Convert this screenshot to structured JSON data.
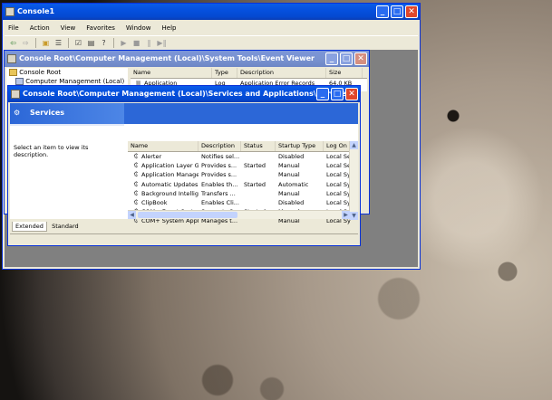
{
  "console_window": {
    "title": "Console1",
    "menu": [
      "File",
      "Action",
      "View",
      "Favorites",
      "Window",
      "Help"
    ],
    "toolbar_icons": [
      "back-icon",
      "forward-icon",
      "up-folder-icon",
      "show-hide-tree-icon",
      "properties-icon",
      "export-list-icon",
      "help-icon",
      "play-icon",
      "stop-icon",
      "pause-icon",
      "restart-icon"
    ]
  },
  "event_viewer_window": {
    "title": "Console Root\\Computer Management (Local)\\System Tools\\Event Viewer",
    "tree": [
      "Console Root",
      "Computer Management (Local)"
    ],
    "columns": [
      "Name",
      "Type",
      "Description",
      "Size"
    ],
    "rows": [
      {
        "name": "Application",
        "type": "Log",
        "description": "Application Error Records",
        "size": "64.0 KB"
      }
    ]
  },
  "services_window": {
    "title": "Console Root\\Computer Management (Local)\\Services and Applications\\Services",
    "header": "Services",
    "left_text": "Select an item to view its description.",
    "columns": [
      "Name",
      "Description",
      "Status",
      "Startup Type",
      "Log On A"
    ],
    "rows": [
      {
        "name": "Alerter",
        "description": "Notifies sel...",
        "status": "",
        "startup": "Disabled",
        "logon": "Local Ser"
      },
      {
        "name": "Application Layer G...",
        "description": "Provides s...",
        "status": "Started",
        "startup": "Manual",
        "logon": "Local Ser"
      },
      {
        "name": "Application Manage...",
        "description": "Provides s...",
        "status": "",
        "startup": "Manual",
        "logon": "Local Sys"
      },
      {
        "name": "Automatic Updates",
        "description": "Enables th...",
        "status": "Started",
        "startup": "Automatic",
        "logon": "Local Sys"
      },
      {
        "name": "Background Intellig...",
        "description": "Transfers ...",
        "status": "",
        "startup": "Manual",
        "logon": "Local Sys"
      },
      {
        "name": "ClipBook",
        "description": "Enables Cli...",
        "status": "",
        "startup": "Disabled",
        "logon": "Local Sys"
      },
      {
        "name": "COM+ Event System",
        "description": "Supports S...",
        "status": "Started",
        "startup": "Manual",
        "logon": "Local Sys"
      },
      {
        "name": "COM+ System Appli...",
        "description": "Manages t...",
        "status": "",
        "startup": "Manual",
        "logon": "Local Sys"
      }
    ],
    "tabs": [
      "Extended",
      "Standard"
    ]
  }
}
